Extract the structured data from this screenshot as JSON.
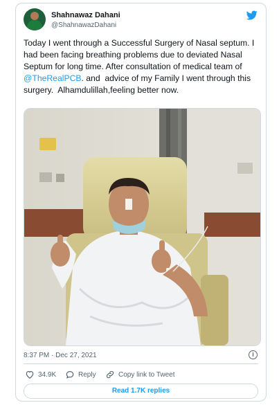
{
  "tweet": {
    "author_name": "Shahnawaz Dahani",
    "author_handle": "@ShahnawazDahani",
    "text_part1": "Today I went through a Successful Surgery of Nasal septum. I had been facing breathing problems due to deviated Nasal Septum for long time. After consultation of medical team of ",
    "mention": "@TheRealPCB",
    "text_part2": ". and  advice of my Family I went through this surgery.  Alhamdulillah,feeling better now.",
    "timestamp": "8:37 PM · Dec 27, 2021",
    "info_glyph": "i"
  },
  "actions": {
    "likes": "34.9K",
    "reply_label": "Reply",
    "copy_label": "Copy link to Tweet"
  },
  "read_replies_label": "Read 1.7K replies",
  "colors": {
    "accent": "#1d9bf0",
    "like_red": "#f91880",
    "border": "#cfd9de",
    "secondary_text": "#536471"
  },
  "icons": {
    "brand": "twitter-bird-icon",
    "like": "heart-icon",
    "reply": "reply-bubble-icon",
    "copy": "link-icon",
    "info": "info-icon"
  }
}
